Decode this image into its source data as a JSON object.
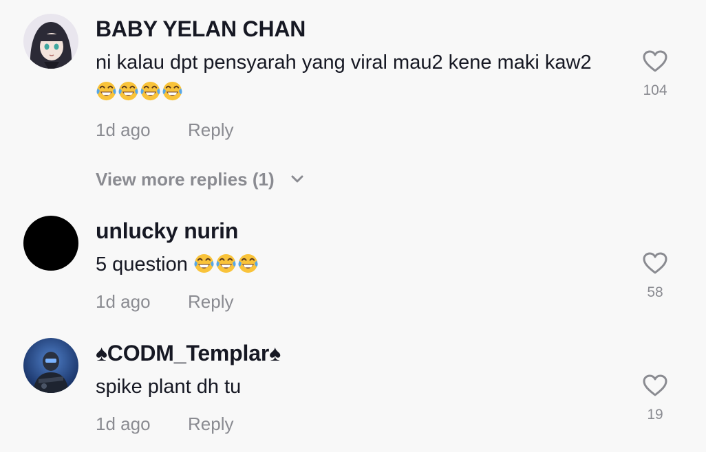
{
  "comments": [
    {
      "username": "BABY YELAN CHAN",
      "text": "ni kalau dpt pensyarah yang viral mau2 kene maki kaw2",
      "emoji_count": 4,
      "time": "1d ago",
      "reply": "Reply",
      "likes": "104",
      "view_more": "View more replies (1)"
    },
    {
      "username": "unlucky nurin",
      "text": "5 question ",
      "emoji_count": 3,
      "time": "1d ago",
      "reply": "Reply",
      "likes": "58"
    },
    {
      "username": "♠CODM_Templar♠",
      "text": "spike plant dh tu",
      "time": "1d ago",
      "reply": "Reply",
      "likes": "19"
    }
  ],
  "emoji_name": "face-with-tears-of-joy",
  "colors": {
    "background": "#f8f8f8",
    "primary_text": "#161823",
    "secondary_text": "#8a8b91"
  }
}
